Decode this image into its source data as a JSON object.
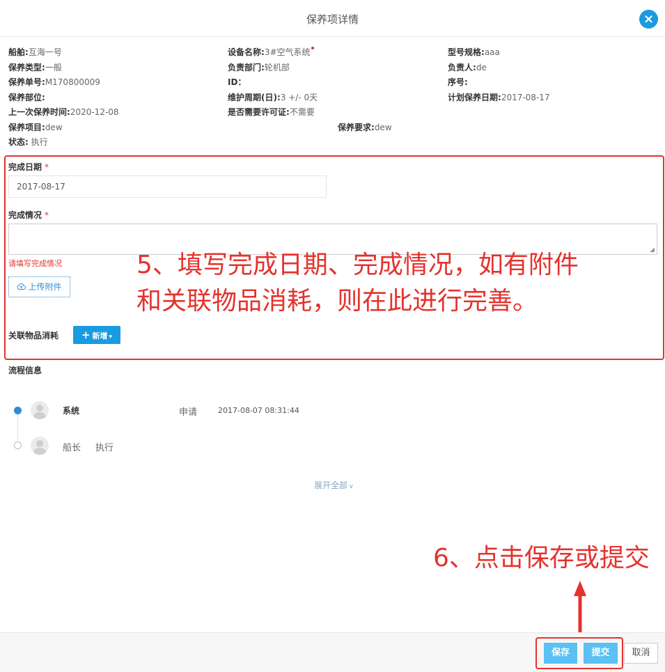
{
  "dialog": {
    "title": "保养项详情",
    "close_label": "×"
  },
  "info": {
    "ship_label": "船舶:",
    "ship_value": "互海一号",
    "device_label": "设备名称:",
    "device_value": "3#空气系统",
    "model_label": "型号规格:",
    "model_value": "aaa",
    "type_label": "保养类型:",
    "type_value": "一般",
    "dept_label": "负责部门:",
    "dept_value": "轮机部",
    "owner_label": "负责人:",
    "owner_value": "de",
    "order_label": "保养单号:",
    "order_value": "M170800009",
    "id_label": "ID：",
    "id_value": "",
    "seq_label": "序号:",
    "seq_value": "",
    "part_label": "保养部位:",
    "part_value": "",
    "cycle_label": "维护周期(日):",
    "cycle_value": "3 +/- 0天",
    "plan_label": "计划保养日期:",
    "plan_value": "2017-08-17",
    "last_label": "上一次保养时间:",
    "last_value": "2020-12-08",
    "permit_label": "是否需要许可证:",
    "permit_value": "不需要",
    "item_label": "保养项目:",
    "item_value": "dew",
    "req_label": "保养要求:",
    "req_value": "dew",
    "status_label": "状态:",
    "status_value": "执行"
  },
  "form": {
    "date_label": "完成日期",
    "date_value": "2017-08-17",
    "result_label": "完成情况",
    "required_mark": "*",
    "result_error": "请填写完成情况",
    "upload_label": "上传附件",
    "related_label": "关联物品消耗",
    "add_label": "新增"
  },
  "annotations": {
    "step5_line1": "5、填写完成日期、完成情况，如有附件",
    "step5_line2": "和关联物品消耗，则在此进行完善。",
    "step6": "6、点击保存或提交"
  },
  "flow": {
    "title": "流程信息",
    "entries": [
      {
        "name": "系统",
        "action": "申请",
        "time": "2017-08-07 08:31:44"
      },
      {
        "name": "船长",
        "action": "执行",
        "time": ""
      }
    ],
    "expand_label": "展开全部"
  },
  "footer": {
    "save_label": "保存",
    "submit_label": "提交",
    "cancel_label": "取消"
  },
  "colors": {
    "accent": "#1a9be0",
    "annotation": "#e5322d",
    "button_light": "#5bc0f2"
  }
}
